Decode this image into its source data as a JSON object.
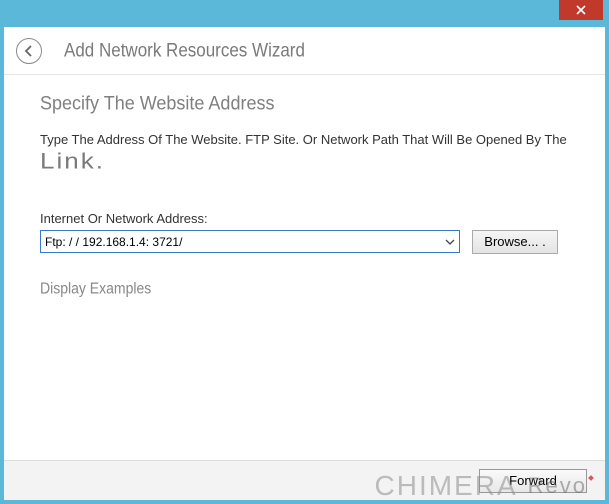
{
  "window": {
    "close_label": "×"
  },
  "titlebar": {
    "title": "Add Network Resources Wizard"
  },
  "content": {
    "heading": "Specify The Website Address",
    "description": "Type The Address Of The Website. FTP Site. Or Network Path That Will Be Opened By The",
    "description2": "Link.",
    "field_label": "Internet Or Network Address:",
    "address_value": "Ftp: / / 192.168.1.4: 3721/",
    "browse_label": "Browse... .",
    "examples_link": "Display Examples"
  },
  "footer": {
    "forward_label": "Forward"
  },
  "watermark": {
    "text1": "CHIMERA",
    "text2": "Revo"
  }
}
